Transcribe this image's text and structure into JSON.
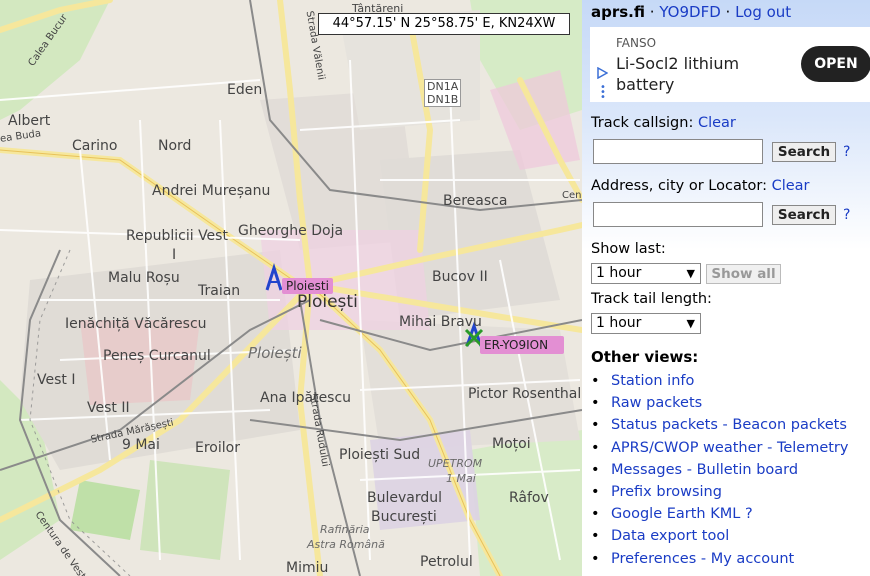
{
  "map": {
    "coordinates": "44°57.15' N 25°58.75' E, KN24XW",
    "labels": {
      "tantareni": "Tântăreni",
      "eden": "Eden",
      "albert": "Albert",
      "carino": "Carino",
      "nord": "Nord",
      "andrei": "Andrei Mureșanu",
      "bereasca": "Bereasca",
      "republicii": "Republicii Vest",
      "republicii2": "I",
      "gheorghe": "Gheorghe Doja",
      "malu": "Malu Roșu",
      "traian": "Traian",
      "bucov": "Bucov II",
      "ploiesti": "Ploiești",
      "ploiesti_area": "Ploiești",
      "ienachita": "Ienăchiță Văcărescu",
      "mihai": "Mihai Bravu",
      "penes": "Peneș Curcanul",
      "vest1": "Vest I",
      "vest2": "Vest II",
      "ana": "Ana Ipătescu",
      "pictor": "Pictor Rosenthal",
      "9mai": "9 Mai",
      "eroilor": "Eroilor",
      "ploiesti_sud": "Ploiești Sud",
      "motoi": "Moțoi",
      "upetrom": "UPETROM",
      "upetrom2": "1 Mai",
      "bulevardul": "Bulevardul",
      "bucuresti": "București",
      "rafov": "Râfov",
      "rafinaria": "Rafinăria",
      "astra": "Astra Română",
      "petrolul": "Petrolul",
      "mimiu": "Mimiu",
      "dn1a": "DN1A",
      "dn1b": "DN1B",
      "calea_bucuresti": "Calea Bucur",
      "strada_valeni": "Strada Vălenii",
      "buda": "ea Buda",
      "strada_marasesti": "Strada Mărășești",
      "strada_rudului": "Strada Rudului",
      "centura": "Centura de Vest",
      "cen": "Cen"
    },
    "stations": [
      {
        "label": "Ploiesti"
      },
      {
        "label": "ER-YO9ION"
      }
    ]
  },
  "panel": {
    "site": "aprs.fi",
    "sep1": " · ",
    "user": "YO9DFD",
    "sep2": " · ",
    "logout": "Log out",
    "ad": {
      "brand": "FANSO",
      "title": "Li-Socl2 lithium battery",
      "cta": "OPEN"
    },
    "track_label": "Track callsign:",
    "track_clear": "Clear",
    "track_value": "",
    "search1": "Search",
    "help1": "?",
    "address_label": "Address, city or Locator:",
    "address_clear": "Clear",
    "address_value": "",
    "search2": "Search",
    "help2": "?",
    "show_last_label": "Show last:",
    "show_last_value": "1 hour",
    "show_all": "Show all",
    "tail_label": "Track tail length:",
    "tail_value": "1 hour",
    "other_views_title": "Other views:",
    "views": [
      {
        "a": "Station info",
        "sep": "",
        "b": ""
      },
      {
        "a": "Raw packets",
        "sep": "",
        "b": ""
      },
      {
        "a": "Status packets",
        "sep": " - ",
        "b": "Beacon packets"
      },
      {
        "a": "APRS/CWOP weather",
        "sep": " - ",
        "b": "Telemetry"
      },
      {
        "a": "Messages",
        "sep": " - ",
        "b": "Bulletin board"
      },
      {
        "a": "Prefix browsing",
        "sep": "",
        "b": ""
      },
      {
        "a": "Google Earth KML ?",
        "sep": "",
        "b": ""
      },
      {
        "a": "Data export tool",
        "sep": "",
        "b": ""
      },
      {
        "a": "Preferences",
        "sep": " - ",
        "b": "My account"
      }
    ]
  }
}
